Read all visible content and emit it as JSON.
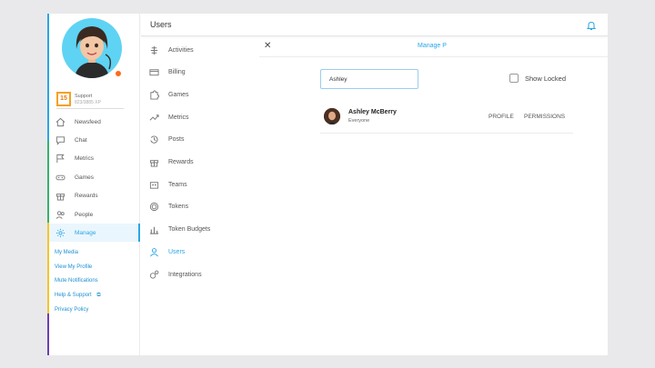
{
  "colors": {
    "accent": "#29a6e6",
    "level": "#f5a023",
    "status": "#ff6a1a"
  },
  "profile": {
    "level": "15",
    "name": "Support",
    "xp": "823/3885 XP"
  },
  "sidebar": {
    "items": [
      {
        "label": "Newsfeed",
        "icon": "home-icon"
      },
      {
        "label": "Chat",
        "icon": "chat-icon"
      },
      {
        "label": "Metrics",
        "icon": "flag-icon"
      },
      {
        "label": "Games",
        "icon": "gamepad-icon"
      },
      {
        "label": "Rewards",
        "icon": "gift-icon"
      },
      {
        "label": "People",
        "icon": "people-icon"
      },
      {
        "label": "Manage",
        "icon": "gear-icon",
        "active": true
      }
    ],
    "links": [
      "My Media",
      "View My Profile",
      "Mute Notifications",
      "Help & Support",
      "Privacy Policy"
    ]
  },
  "header": {
    "title": "Users"
  },
  "manage_menu": {
    "items": [
      {
        "label": "Activities",
        "icon": "activities-icon"
      },
      {
        "label": "Billing",
        "icon": "billing-icon"
      },
      {
        "label": "Games",
        "icon": "puzzle-icon"
      },
      {
        "label": "Metrics",
        "icon": "trend-icon"
      },
      {
        "label": "Posts",
        "icon": "history-icon"
      },
      {
        "label": "Rewards",
        "icon": "gift-icon"
      },
      {
        "label": "Teams",
        "icon": "teams-icon"
      },
      {
        "label": "Tokens",
        "icon": "token-icon"
      },
      {
        "label": "Token Budgets",
        "icon": "budget-icon"
      },
      {
        "label": "Users",
        "icon": "user-icon",
        "active": true
      },
      {
        "label": "Integrations",
        "icon": "integrations-icon"
      }
    ]
  },
  "panel": {
    "title": "Manage P",
    "search_value": "Ashley",
    "show_locked_label": "Show Locked",
    "users": [
      {
        "name": "Ashley McBerry",
        "group": "Everyone",
        "profile_label": "PROFILE",
        "permissions_label": "PERMISSIONS"
      }
    ]
  }
}
